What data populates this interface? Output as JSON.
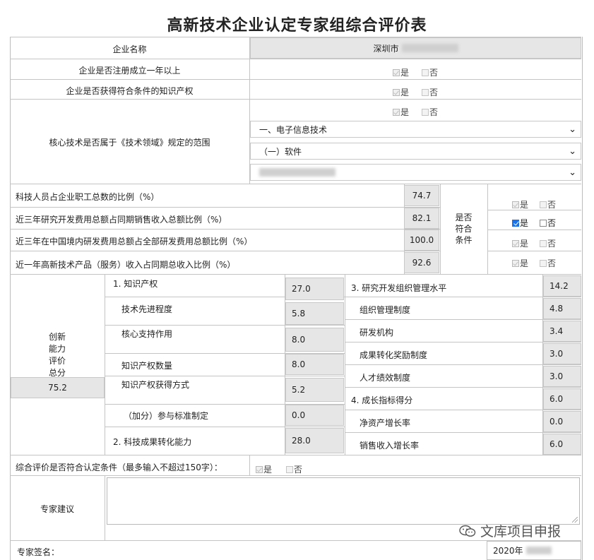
{
  "title": "高新技术企业认定专家组综合评价表",
  "company": {
    "label": "企业名称",
    "value": "深圳市"
  },
  "yes": "是",
  "no": "否",
  "rows": {
    "registered": "企业是否注册成立一年以上",
    "ip": "企业是否获得符合条件的知识产权",
    "core_tech": "核心技术是否属于《技术领域》规定的范围"
  },
  "selects": {
    "domain": "一、电子信息技术",
    "sub": "（一）软件"
  },
  "ratios": [
    {
      "label": "科技人员占企业职工总数的比例（%）",
      "value": "74.7"
    },
    {
      "label": "近三年研究开发费用总额占同期销售收入总额比例（%）",
      "value": "82.1"
    },
    {
      "label": "近三年在中国境内研发费用总额占全部研发费用总额比例（%）",
      "value": "100.0"
    },
    {
      "label": "近一年高新技术产品（服务）收入占同期总收入比例（%）",
      "value": "92.6"
    }
  ],
  "meets": {
    "l1": "是否",
    "l2": "符合",
    "l3": "条件"
  },
  "innovation": {
    "label_lines": [
      "创新",
      "能力",
      "评价",
      "总分"
    ],
    "total": "75.2",
    "left": [
      {
        "label": "1. 知识产权",
        "value": "27.0"
      },
      {
        "label": "技术先进程度",
        "value": "5.8"
      },
      {
        "label": "核心支持作用",
        "value": "8.0"
      },
      {
        "label": "知识产权数量",
        "value": "8.0"
      },
      {
        "label": "知识产权获得方式",
        "value": "5.2"
      },
      {
        "label": "（加分）参与标准制定",
        "value": "0.0"
      },
      {
        "label": "2. 科技成果转化能力",
        "value": "28.0"
      }
    ],
    "right": [
      {
        "label": "3. 研究开发组织管理水平",
        "value": "14.2"
      },
      {
        "label": "组织管理制度",
        "value": "4.8"
      },
      {
        "label": "研发机构",
        "value": "3.4"
      },
      {
        "label": "成果转化奖励制度",
        "value": "3.0"
      },
      {
        "label": "人才绩效制度",
        "value": "3.0"
      },
      {
        "label": "4. 成长指标得分",
        "value": "6.0"
      },
      {
        "label": "净资产增长率",
        "value": "0.0"
      },
      {
        "label": "销售收入增长率",
        "value": "6.0"
      }
    ]
  },
  "overall": {
    "label": "综合评价是否符合认定条件（最多输入不超过150字）："
  },
  "advice": {
    "label": "专家建议"
  },
  "signature": {
    "label": "专家签名：",
    "date": "2020年"
  },
  "watermark": "文库项目申报"
}
